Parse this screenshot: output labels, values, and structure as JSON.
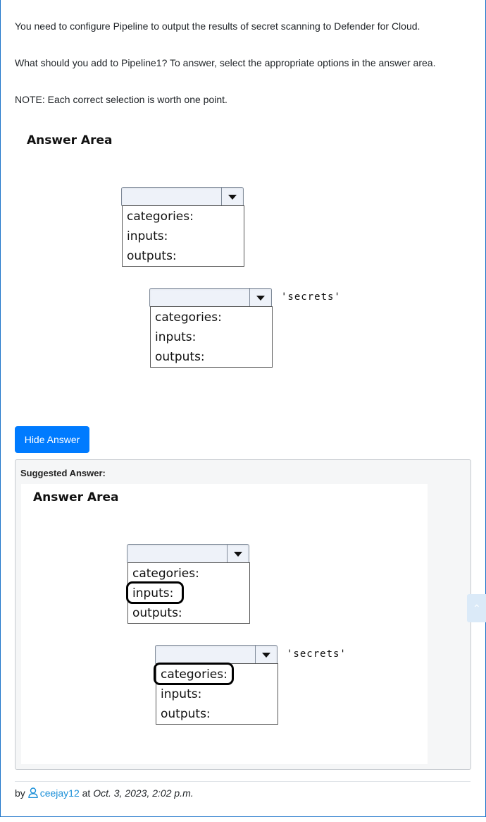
{
  "question": {
    "line1": "You need to configure Pipeline to output the results of secret scanning to Defender for Cloud.",
    "line2": "What should you add to Pipeline1? To answer, select the appropriate options in the answer area.",
    "line3": "NOTE: Each correct selection is worth one point."
  },
  "answer_area": {
    "title": "Answer Area",
    "dropdown1": {
      "selected": "",
      "options": [
        "categories:",
        "inputs:",
        "outputs:"
      ]
    },
    "dropdown2": {
      "selected": "",
      "options": [
        "categories:",
        "inputs:",
        "outputs:"
      ],
      "trailing_text": "'secrets'"
    }
  },
  "hide_button": {
    "label": "Hide Answer"
  },
  "suggested": {
    "label": "Suggested Answer:",
    "title": "Answer Area",
    "dropdown1": {
      "options": [
        "categories:",
        "inputs:",
        "outputs:"
      ],
      "circled": "inputs:"
    },
    "dropdown2": {
      "options": [
        "categories:",
        "inputs:",
        "outputs:"
      ],
      "circled": "categories:",
      "trailing_text": "'secrets'"
    }
  },
  "footer": {
    "by": "by",
    "user": "ceejay12",
    "at": "at",
    "date": "Oct. 3, 2023, 2:02 p.m."
  },
  "colors": {
    "accent": "#007bff",
    "link": "#1a8fd8",
    "frame": "#1a73c9"
  },
  "icons": {
    "scroll_top": "chevron-up-icon",
    "user": "user-icon"
  }
}
